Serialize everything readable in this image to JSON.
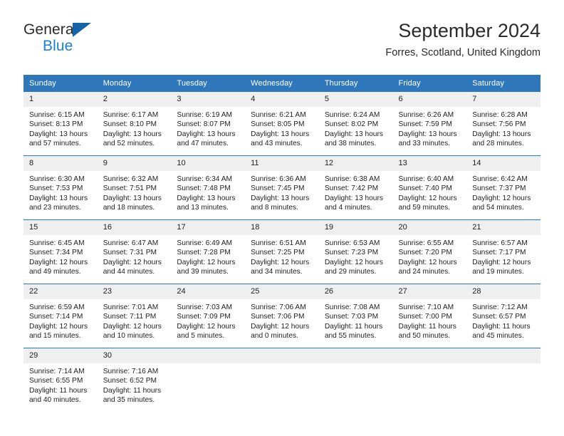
{
  "brand": {
    "line1": "General",
    "line2": "Blue",
    "accent_color": "#1b7fd4",
    "triangle_color": "#1763a8"
  },
  "header": {
    "title": "September 2024",
    "subtitle": "Forres, Scotland, United Kingdom"
  },
  "theme": {
    "header_row_bg": "#2e77bb",
    "daynum_bg": "#efefef",
    "grid_line": "#2e77bb",
    "text": "#1f1f1f"
  },
  "weekday_headers": [
    "Sunday",
    "Monday",
    "Tuesday",
    "Wednesday",
    "Thursday",
    "Friday",
    "Saturday"
  ],
  "weeks": [
    [
      {
        "day": "1",
        "sunrise": "Sunrise: 6:15 AM",
        "sunset": "Sunset: 8:13 PM",
        "daylight1": "Daylight: 13 hours",
        "daylight2": "and 57 minutes."
      },
      {
        "day": "2",
        "sunrise": "Sunrise: 6:17 AM",
        "sunset": "Sunset: 8:10 PM",
        "daylight1": "Daylight: 13 hours",
        "daylight2": "and 52 minutes."
      },
      {
        "day": "3",
        "sunrise": "Sunrise: 6:19 AM",
        "sunset": "Sunset: 8:07 PM",
        "daylight1": "Daylight: 13 hours",
        "daylight2": "and 47 minutes."
      },
      {
        "day": "4",
        "sunrise": "Sunrise: 6:21 AM",
        "sunset": "Sunset: 8:05 PM",
        "daylight1": "Daylight: 13 hours",
        "daylight2": "and 43 minutes."
      },
      {
        "day": "5",
        "sunrise": "Sunrise: 6:24 AM",
        "sunset": "Sunset: 8:02 PM",
        "daylight1": "Daylight: 13 hours",
        "daylight2": "and 38 minutes."
      },
      {
        "day": "6",
        "sunrise": "Sunrise: 6:26 AM",
        "sunset": "Sunset: 7:59 PM",
        "daylight1": "Daylight: 13 hours",
        "daylight2": "and 33 minutes."
      },
      {
        "day": "7",
        "sunrise": "Sunrise: 6:28 AM",
        "sunset": "Sunset: 7:56 PM",
        "daylight1": "Daylight: 13 hours",
        "daylight2": "and 28 minutes."
      }
    ],
    [
      {
        "day": "8",
        "sunrise": "Sunrise: 6:30 AM",
        "sunset": "Sunset: 7:53 PM",
        "daylight1": "Daylight: 13 hours",
        "daylight2": "and 23 minutes."
      },
      {
        "day": "9",
        "sunrise": "Sunrise: 6:32 AM",
        "sunset": "Sunset: 7:51 PM",
        "daylight1": "Daylight: 13 hours",
        "daylight2": "and 18 minutes."
      },
      {
        "day": "10",
        "sunrise": "Sunrise: 6:34 AM",
        "sunset": "Sunset: 7:48 PM",
        "daylight1": "Daylight: 13 hours",
        "daylight2": "and 13 minutes."
      },
      {
        "day": "11",
        "sunrise": "Sunrise: 6:36 AM",
        "sunset": "Sunset: 7:45 PM",
        "daylight1": "Daylight: 13 hours",
        "daylight2": "and 8 minutes."
      },
      {
        "day": "12",
        "sunrise": "Sunrise: 6:38 AM",
        "sunset": "Sunset: 7:42 PM",
        "daylight1": "Daylight: 13 hours",
        "daylight2": "and 4 minutes."
      },
      {
        "day": "13",
        "sunrise": "Sunrise: 6:40 AM",
        "sunset": "Sunset: 7:40 PM",
        "daylight1": "Daylight: 12 hours",
        "daylight2": "and 59 minutes."
      },
      {
        "day": "14",
        "sunrise": "Sunrise: 6:42 AM",
        "sunset": "Sunset: 7:37 PM",
        "daylight1": "Daylight: 12 hours",
        "daylight2": "and 54 minutes."
      }
    ],
    [
      {
        "day": "15",
        "sunrise": "Sunrise: 6:45 AM",
        "sunset": "Sunset: 7:34 PM",
        "daylight1": "Daylight: 12 hours",
        "daylight2": "and 49 minutes."
      },
      {
        "day": "16",
        "sunrise": "Sunrise: 6:47 AM",
        "sunset": "Sunset: 7:31 PM",
        "daylight1": "Daylight: 12 hours",
        "daylight2": "and 44 minutes."
      },
      {
        "day": "17",
        "sunrise": "Sunrise: 6:49 AM",
        "sunset": "Sunset: 7:28 PM",
        "daylight1": "Daylight: 12 hours",
        "daylight2": "and 39 minutes."
      },
      {
        "day": "18",
        "sunrise": "Sunrise: 6:51 AM",
        "sunset": "Sunset: 7:25 PM",
        "daylight1": "Daylight: 12 hours",
        "daylight2": "and 34 minutes."
      },
      {
        "day": "19",
        "sunrise": "Sunrise: 6:53 AM",
        "sunset": "Sunset: 7:23 PM",
        "daylight1": "Daylight: 12 hours",
        "daylight2": "and 29 minutes."
      },
      {
        "day": "20",
        "sunrise": "Sunrise: 6:55 AM",
        "sunset": "Sunset: 7:20 PM",
        "daylight1": "Daylight: 12 hours",
        "daylight2": "and 24 minutes."
      },
      {
        "day": "21",
        "sunrise": "Sunrise: 6:57 AM",
        "sunset": "Sunset: 7:17 PM",
        "daylight1": "Daylight: 12 hours",
        "daylight2": "and 19 minutes."
      }
    ],
    [
      {
        "day": "22",
        "sunrise": "Sunrise: 6:59 AM",
        "sunset": "Sunset: 7:14 PM",
        "daylight1": "Daylight: 12 hours",
        "daylight2": "and 15 minutes."
      },
      {
        "day": "23",
        "sunrise": "Sunrise: 7:01 AM",
        "sunset": "Sunset: 7:11 PM",
        "daylight1": "Daylight: 12 hours",
        "daylight2": "and 10 minutes."
      },
      {
        "day": "24",
        "sunrise": "Sunrise: 7:03 AM",
        "sunset": "Sunset: 7:09 PM",
        "daylight1": "Daylight: 12 hours",
        "daylight2": "and 5 minutes."
      },
      {
        "day": "25",
        "sunrise": "Sunrise: 7:06 AM",
        "sunset": "Sunset: 7:06 PM",
        "daylight1": "Daylight: 12 hours",
        "daylight2": "and 0 minutes."
      },
      {
        "day": "26",
        "sunrise": "Sunrise: 7:08 AM",
        "sunset": "Sunset: 7:03 PM",
        "daylight1": "Daylight: 11 hours",
        "daylight2": "and 55 minutes."
      },
      {
        "day": "27",
        "sunrise": "Sunrise: 7:10 AM",
        "sunset": "Sunset: 7:00 PM",
        "daylight1": "Daylight: 11 hours",
        "daylight2": "and 50 minutes."
      },
      {
        "day": "28",
        "sunrise": "Sunrise: 7:12 AM",
        "sunset": "Sunset: 6:57 PM",
        "daylight1": "Daylight: 11 hours",
        "daylight2": "and 45 minutes."
      }
    ],
    [
      {
        "day": "29",
        "sunrise": "Sunrise: 7:14 AM",
        "sunset": "Sunset: 6:55 PM",
        "daylight1": "Daylight: 11 hours",
        "daylight2": "and 40 minutes."
      },
      {
        "day": "30",
        "sunrise": "Sunrise: 7:16 AM",
        "sunset": "Sunset: 6:52 PM",
        "daylight1": "Daylight: 11 hours",
        "daylight2": "and 35 minutes."
      },
      {
        "day": "",
        "sunrise": "",
        "sunset": "",
        "daylight1": "",
        "daylight2": ""
      },
      {
        "day": "",
        "sunrise": "",
        "sunset": "",
        "daylight1": "",
        "daylight2": ""
      },
      {
        "day": "",
        "sunrise": "",
        "sunset": "",
        "daylight1": "",
        "daylight2": ""
      },
      {
        "day": "",
        "sunrise": "",
        "sunset": "",
        "daylight1": "",
        "daylight2": ""
      },
      {
        "day": "",
        "sunrise": "",
        "sunset": "",
        "daylight1": "",
        "daylight2": ""
      }
    ]
  ]
}
